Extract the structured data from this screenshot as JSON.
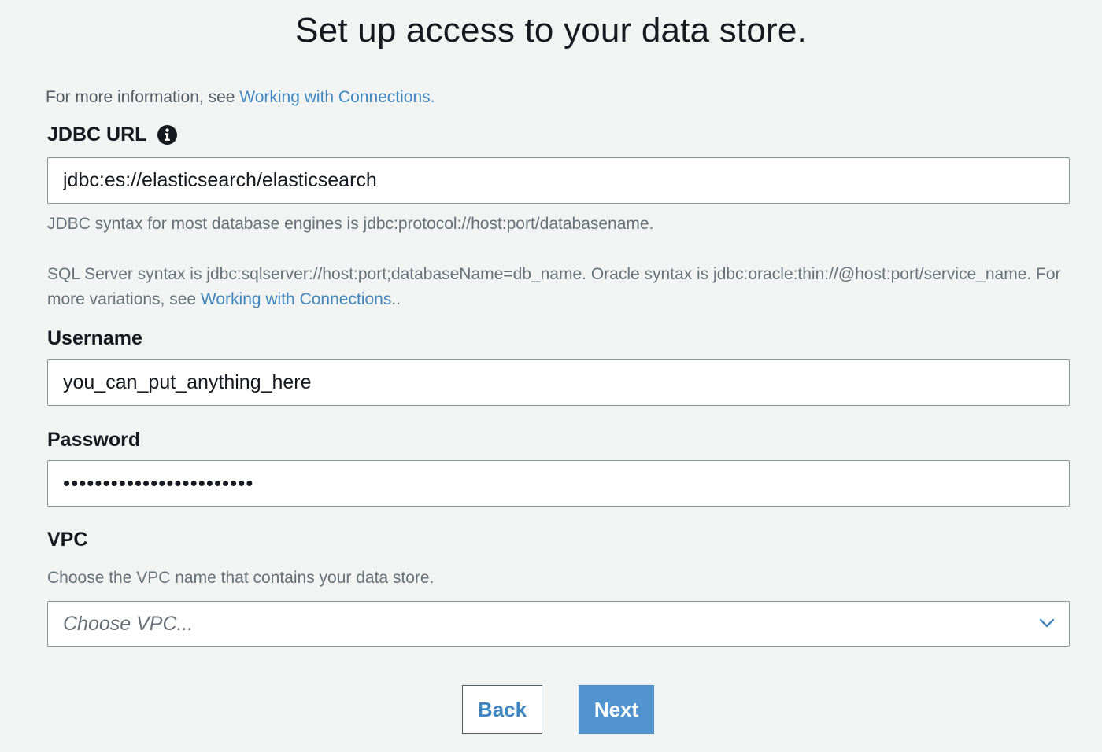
{
  "page": {
    "title": "Set up access to your data store."
  },
  "info": {
    "prefix": "For more information, see ",
    "link": "Working with Connections."
  },
  "jdbc": {
    "label": "JDBC URL",
    "value": "jdbc:es://elasticsearch/elasticsearch",
    "help_line1": "JDBC syntax for most database engines is jdbc:protocol://host:port/databasename.",
    "help_sql_prefix": "SQL Server syntax is jdbc:sqlserver://host:port;databaseName=db_name. Oracle syntax is jdbc:oracle:thin://@host:port/service_name. For more variations, see ",
    "help_sql_link": "Working with Connections",
    "help_sql_suffix": ".."
  },
  "username": {
    "label": "Username",
    "value": "you_can_put_anything_here"
  },
  "password": {
    "label": "Password",
    "masked_value": "••••••••••••••••••••••••"
  },
  "vpc": {
    "label": "VPC",
    "help": "Choose the VPC name that contains your data store.",
    "placeholder": "Choose VPC..."
  },
  "buttons": {
    "back": "Back",
    "next": "Next"
  },
  "colors": {
    "link": "#3f86bf",
    "primary": "#5294cf",
    "background": "#f2f3f3"
  },
  "icons": {
    "info": "info-icon",
    "dropdown": "chevron-down-icon"
  }
}
